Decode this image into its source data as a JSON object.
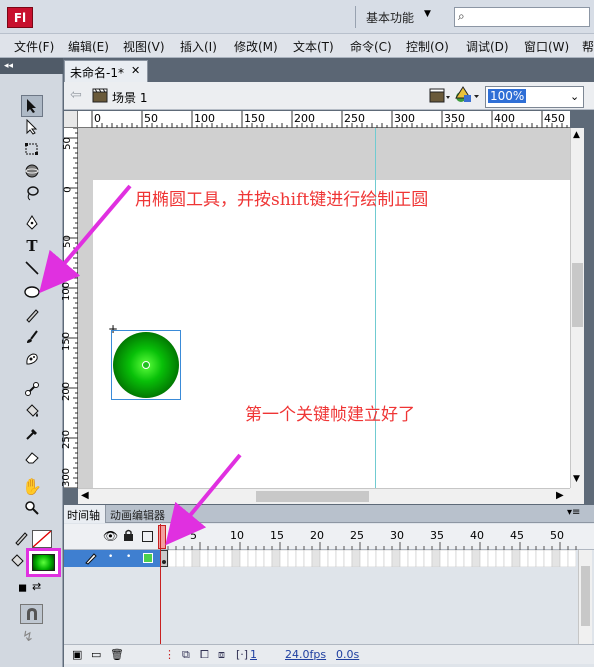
{
  "app": {
    "logo": "Fl",
    "workspace": "基本功能"
  },
  "search": {
    "placeholder": ""
  },
  "menu": [
    "文件(F)",
    "编辑(E)",
    "视图(V)",
    "插入(I)",
    "修改(M)",
    "文本(T)",
    "命令(C)",
    "控制(O)",
    "调试(D)",
    "窗口(W)",
    "帮"
  ],
  "document": {
    "tab_title": "未命名-1*",
    "scene": "场景 1",
    "zoom": "100%"
  },
  "rulers": {
    "top": [
      "0",
      "50",
      "100",
      "150",
      "200",
      "250",
      "300",
      "350",
      "400",
      "450"
    ],
    "left": [
      "50",
      "0",
      "50",
      "100",
      "150",
      "200",
      "250",
      "300"
    ]
  },
  "annotations": {
    "draw_tip": "用椭圆工具，并按shift键进行绘制正圆",
    "keyframe_tip": "第一个关键帧建立好了"
  },
  "timeline": {
    "tab_timeline": "时间轴",
    "tab_motion_editor": "动画编辑器",
    "frame_numbers": [
      "5",
      "10",
      "15",
      "20",
      "25",
      "30",
      "35",
      "40",
      "45",
      "50"
    ],
    "current_frame": "1",
    "fps": "24.0fps",
    "elapsed": "0.0s"
  },
  "colors": {
    "fill": "#00c000",
    "highlight": "#e030e0",
    "annotation": "#ef3535",
    "guide": "#70cbd1"
  }
}
